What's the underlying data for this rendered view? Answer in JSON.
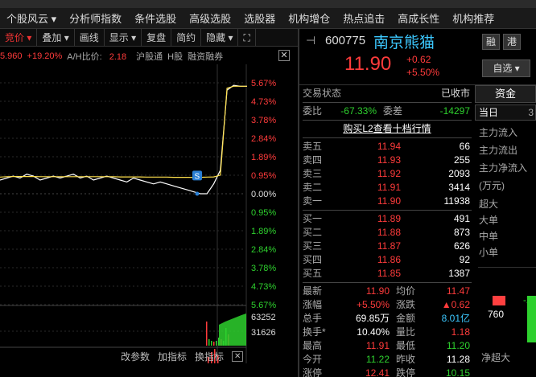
{
  "menu": [
    "个股风云 ▾",
    "分析师指数",
    "条件选股",
    "高级选股",
    "选股器",
    "机构增仓",
    "热点追击",
    "高成长性",
    "机构推荐"
  ],
  "toolbar": [
    {
      "label": "竞价 ▾",
      "active": true
    },
    {
      "label": "叠加 ▾",
      "active": false
    },
    {
      "label": "画线",
      "active": false
    },
    {
      "label": "显示 ▾",
      "active": false
    },
    {
      "label": "复盘",
      "active": false
    },
    {
      "label": "简约",
      "active": false
    },
    {
      "label": "隐藏 ▾",
      "active": false
    }
  ],
  "chart_info": {
    "price": "5.960",
    "pct": "+19.20%",
    "ah_label": "A/H比价:",
    "ah_value": "2.18",
    "hk": "沪股通",
    "h": "H股",
    "rz": "融资融券"
  },
  "chart_data": {
    "type": "line",
    "yaxis_labels": [
      "5.67%",
      "4.73%",
      "3.78%",
      "2.84%",
      "1.89%",
      "0.95%",
      "0.00%",
      "0.95%",
      "1.89%",
      "2.84%",
      "3.78%",
      "4.73%",
      "5.67%"
    ],
    "volume_labels": [
      "63252",
      "31626"
    ],
    "marker_label": "S",
    "series": [
      {
        "color": "#ffffff",
        "values": [
          0.7,
          0.8,
          0.9,
          0.8,
          1.0,
          0.9,
          0.7,
          0.8,
          0.9,
          0.8,
          0.9,
          1.0,
          0.8,
          0.9,
          0.7,
          0.8,
          0.9,
          0.8,
          0.7,
          0.6,
          0.8,
          0.7,
          0.6,
          0.5,
          0.6,
          0.5,
          0.4,
          0.3,
          0.2,
          0.1,
          0.0,
          0.0,
          0.5,
          1.2,
          5.3,
          5.55,
          5.5,
          5.5
        ]
      },
      {
        "color": "#ffe14d",
        "values": [
          0.85,
          0.87,
          0.88,
          0.88,
          0.88,
          0.88,
          0.87,
          0.87,
          0.87,
          0.87,
          0.87,
          0.87,
          0.87,
          0.87,
          0.87,
          0.87,
          0.87,
          0.87,
          0.86,
          0.86,
          0.86,
          0.86,
          0.85,
          0.85,
          0.85,
          0.85,
          0.84,
          0.84,
          0.84,
          0.84,
          0.84,
          0.85,
          0.86,
          0.95,
          5.4,
          5.5,
          5.5,
          5.5
        ]
      }
    ]
  },
  "chart_buttons": [
    "改参数",
    "加指标",
    "换指标"
  ],
  "stock": {
    "code": "600775",
    "name": "南京熊猫",
    "price": "11.90",
    "chg": "+0.62",
    "pct": "+5.50%"
  },
  "side_buttons": {
    "rz": "融",
    "gg": "港",
    "zixuan": "自选 ▾"
  },
  "status": {
    "label": "交易状态",
    "value": "已收市"
  },
  "weibi": {
    "label": "委比",
    "value": "-67.33%",
    "label2": "委差",
    "value2": "-14297"
  },
  "l2_link": "购买L2查看十档行情",
  "sell": [
    {
      "label": "卖五",
      "price": "11.94",
      "vol": "66"
    },
    {
      "label": "卖四",
      "price": "11.93",
      "vol": "255"
    },
    {
      "label": "卖三",
      "price": "11.92",
      "vol": "2093"
    },
    {
      "label": "卖二",
      "price": "11.91",
      "vol": "3414"
    },
    {
      "label": "卖一",
      "price": "11.90",
      "vol": "11938"
    }
  ],
  "buy": [
    {
      "label": "买一",
      "price": "11.89",
      "vol": "491"
    },
    {
      "label": "买二",
      "price": "11.88",
      "vol": "873"
    },
    {
      "label": "买三",
      "price": "11.87",
      "vol": "626"
    },
    {
      "label": "买四",
      "price": "11.86",
      "vol": "92"
    },
    {
      "label": "买五",
      "price": "11.85",
      "vol": "1387"
    }
  ],
  "stats": [
    {
      "l1": "最新",
      "v1": "11.90",
      "c1": "red",
      "l2": "均价",
      "v2": "11.47",
      "c2": "red"
    },
    {
      "l1": "涨幅",
      "v1": "+5.50%",
      "c1": "red",
      "l2": "涨跌",
      "v2": "▲0.62",
      "c2": "red"
    },
    {
      "l1": "总手",
      "v1": "69.85万",
      "c1": "white",
      "l2": "金额",
      "v2": "8.01亿",
      "c2": "cyan"
    },
    {
      "l1": "换手*",
      "v1": "10.40%",
      "c1": "white",
      "l2": "量比",
      "v2": "1.18",
      "c2": "red"
    },
    {
      "l1": "最高",
      "v1": "11.91",
      "c1": "red",
      "l2": "最低",
      "v2": "11.20",
      "c2": "green"
    },
    {
      "l1": "今开",
      "v1": "11.22",
      "c1": "green",
      "l2": "昨收",
      "v2": "11.28",
      "c2": "white"
    },
    {
      "l1": "涨停",
      "v1": "12.41",
      "c1": "red",
      "l2": "跌停",
      "v2": "10.15",
      "c2": "green"
    }
  ],
  "capital": {
    "tab": "资金",
    "subtab": "当日",
    "subtab_num": "3",
    "flows": [
      "主力流入",
      "主力流出",
      "主力净流入"
    ],
    "unit": "(万元)",
    "sizes": [
      "超大",
      "大单",
      "中单",
      "小单"
    ],
    "bar_value": "760",
    "bar_neg": "-2",
    "net_label": "净超大"
  },
  "colors": {
    "up": "#ff3b3b",
    "down": "#2ed12e",
    "accent": "#3cc8ff"
  }
}
